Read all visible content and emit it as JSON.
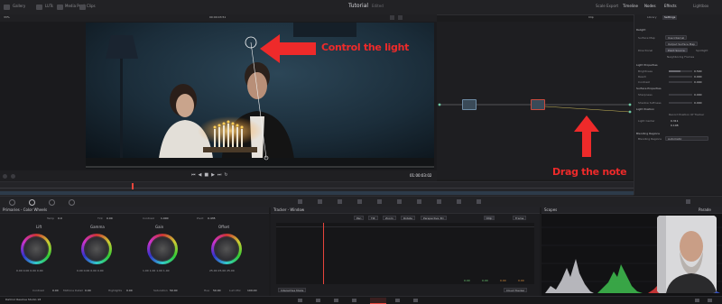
{
  "app": {
    "title": "Tutorial",
    "subtitle": "Edited",
    "product": "DaVinci Resolve Studio 18"
  },
  "topbar": {
    "tabs": [
      "Gallery",
      "LUTs",
      "Media Pool",
      "Clips"
    ],
    "right_tabs": [
      "Scale Export",
      "Timeline",
      "Nodes",
      "Effects",
      "Lightbox"
    ],
    "zoom": "33%",
    "timecode": "00:00:03:51",
    "clip_label": "Clip"
  },
  "panel_tabs": {
    "library": "Library",
    "settings": "Settings"
  },
  "viewer": {
    "timecode": "01:00:03:02",
    "annotation_top": "Control the light",
    "annotation_bottom": "Drag the note"
  },
  "relight": {
    "section": "Relight",
    "surface_map_label": "Surface Map",
    "surface_map_value": "Use Internal",
    "surface_btn": "Output Surface Map",
    "directional_label": "Directional",
    "point_source": "Point Source",
    "spotlight": "Spotlight",
    "neighboring": "Neighboring Frames",
    "light_props": "Light Properties",
    "brightness_label": "Brightness",
    "brightness": "0.500",
    "reach_label": "Reach",
    "reach": "0.000",
    "contrast_label": "Contrast",
    "contrast": "0.000",
    "surface_props": "Surface Properties",
    "sharpness_label": "Sharpness",
    "sharpness": "0.000",
    "shadow_label": "Shadow Softness",
    "shadow": "0.000",
    "light_position": "Light Position",
    "record_position": "Record Position Of Tracker",
    "light_center_label": "Light Center",
    "light_x": "0.311",
    "light_y": "0.108",
    "blending": "Blending Regions",
    "blending_mode_label": "Blending Regions",
    "blending_mode": "Automatic"
  },
  "color_wheels": {
    "header": "Primaries - Color Wheels",
    "temp_label": "Temp",
    "temp": "0.0",
    "tint_label": "Tint",
    "tint": "0.00",
    "contrast_label": "Contrast",
    "contrast": "1.000",
    "pivot_label": "Pivot",
    "pivot": "0.435",
    "wheels": [
      {
        "name": "Lift",
        "values": "0.00  0.00  0.00  0.00"
      },
      {
        "name": "Gamma",
        "values": "0.00  0.00  0.00  0.00"
      },
      {
        "name": "Gain",
        "values": "1.00  1.00  1.00  1.00"
      },
      {
        "name": "Offset",
        "values": "25.00  25.00  25.00"
      }
    ],
    "footer": [
      {
        "label": "Contrast",
        "value": "0.00"
      },
      {
        "label": "Midtone Detail",
        "value": "0.00"
      },
      {
        "label": "Highlights",
        "value": "0.00"
      },
      {
        "label": "Saturation",
        "value": "50.00"
      },
      {
        "label": "Hue",
        "value": "50.00"
      },
      {
        "label": "Lum Mix",
        "value": "100.00"
      }
    ]
  },
  "tracker": {
    "header": "Tracker - Window",
    "options": [
      "Pan",
      "Tilt",
      "Zoom",
      "Rotate",
      "Perspective 3D"
    ],
    "clip_btn": "Clip",
    "frame_btn": "Frame",
    "footer_left": "Interactive Mode",
    "footer_right": "Cloud Tracker",
    "values": [
      "0.00",
      "0.00",
      "0.00",
      "0.00"
    ]
  },
  "scopes": {
    "header": "Scopes",
    "mode": "Parade"
  },
  "colors": {
    "annotation_red": "#ee2a2a",
    "accent": "#e8453c"
  }
}
